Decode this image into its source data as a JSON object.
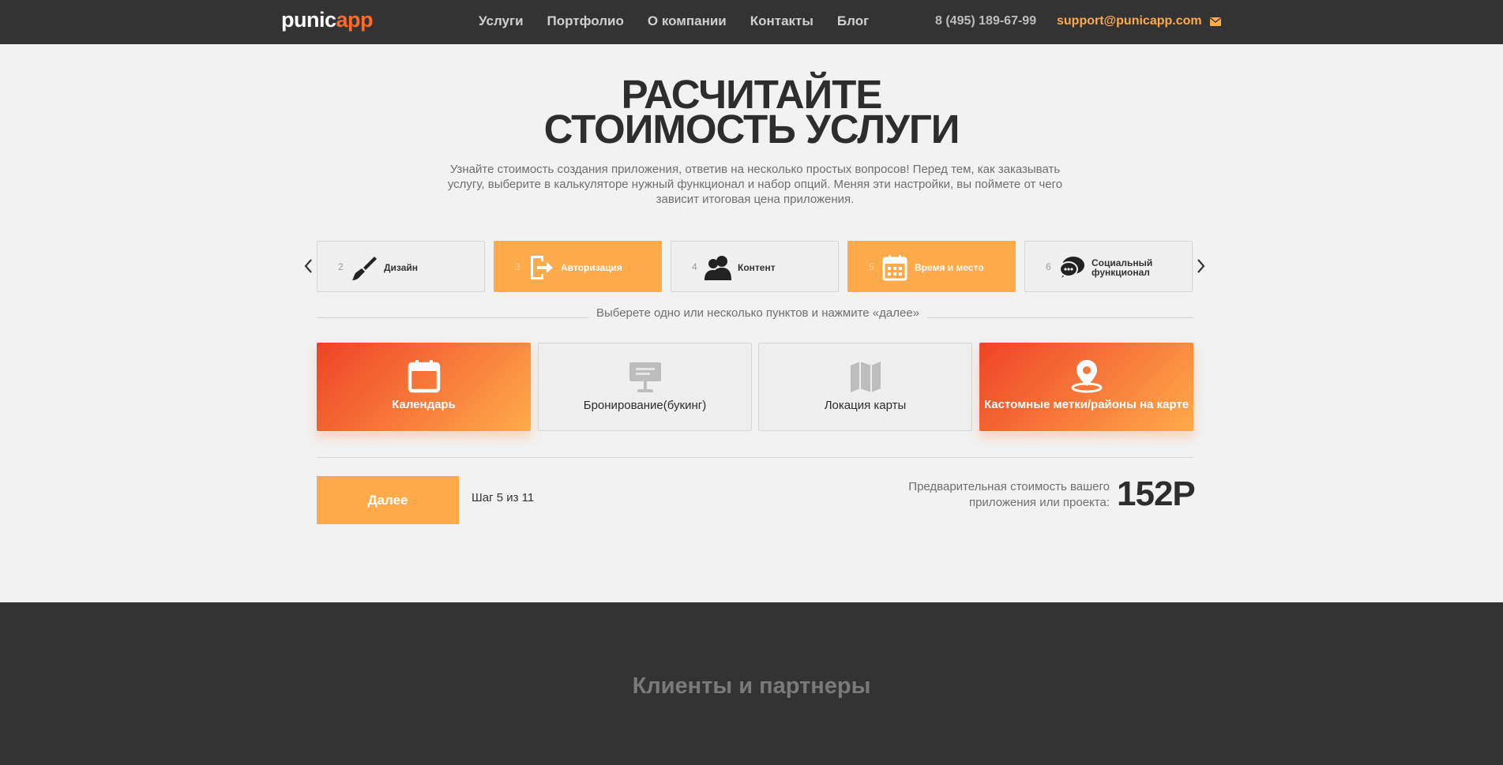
{
  "header": {
    "logo_main": "punic",
    "logo_accent": "app",
    "nav": [
      "Услуги",
      "Портфолио",
      "О компании",
      "Контакты",
      "Блог"
    ],
    "phone": "8 (495) 189-67-99",
    "email": "support@punicapp.com"
  },
  "hero": {
    "title_line1": "РАСЧИТАЙТЕ",
    "title_line2": "СТОИМОСТЬ УСЛУГИ",
    "subtitle": "Узнайте стоимость создания приложения, ответив на несколько простых вопросов! Перед тем, как заказывать услугу, выберите в калькуляторе нужный функционал и набор опций. Меняя эти настройки, вы поймете от чего зависит итоговая цена приложения."
  },
  "steps": [
    {
      "num": "2",
      "label": "Дизайн",
      "icon": "brush-icon",
      "active": false
    },
    {
      "num": "3",
      "label": "Авторизация",
      "icon": "sign-in-icon",
      "active": true
    },
    {
      "num": "4",
      "label": "Контент",
      "icon": "users-icon",
      "active": false
    },
    {
      "num": "5",
      "label": "Время и место",
      "icon": "calendar-icon",
      "active": true
    },
    {
      "num": "6",
      "label": "Социальный функционал",
      "icon": "chat-icon",
      "active": false
    }
  ],
  "hint": "Выберете одно или несколько пунктов и нажмите «далее»",
  "options": [
    {
      "label": "Календарь",
      "icon": "calendar-icon",
      "selected": true
    },
    {
      "label": "Бронирование(букинг)",
      "icon": "booking-icon",
      "selected": false
    },
    {
      "label": "Локация карты",
      "icon": "map-icon",
      "selected": false
    },
    {
      "label": "Кастомные метки/районы на карте",
      "icon": "map-pin-icon",
      "selected": true
    }
  ],
  "controls": {
    "next_label": "Далее",
    "step_count": "Шаг 5 из 11",
    "price_label": "Предварительная стоимость вашего приложения или проекта:",
    "price": "152Р"
  },
  "footer": {
    "title": "Клиенты и партнеры"
  },
  "colors": {
    "accent": "#ffaa4b",
    "accent_dark": "#ee4326",
    "header_bg": "#333333",
    "page_bg": "#f2f2f2"
  }
}
